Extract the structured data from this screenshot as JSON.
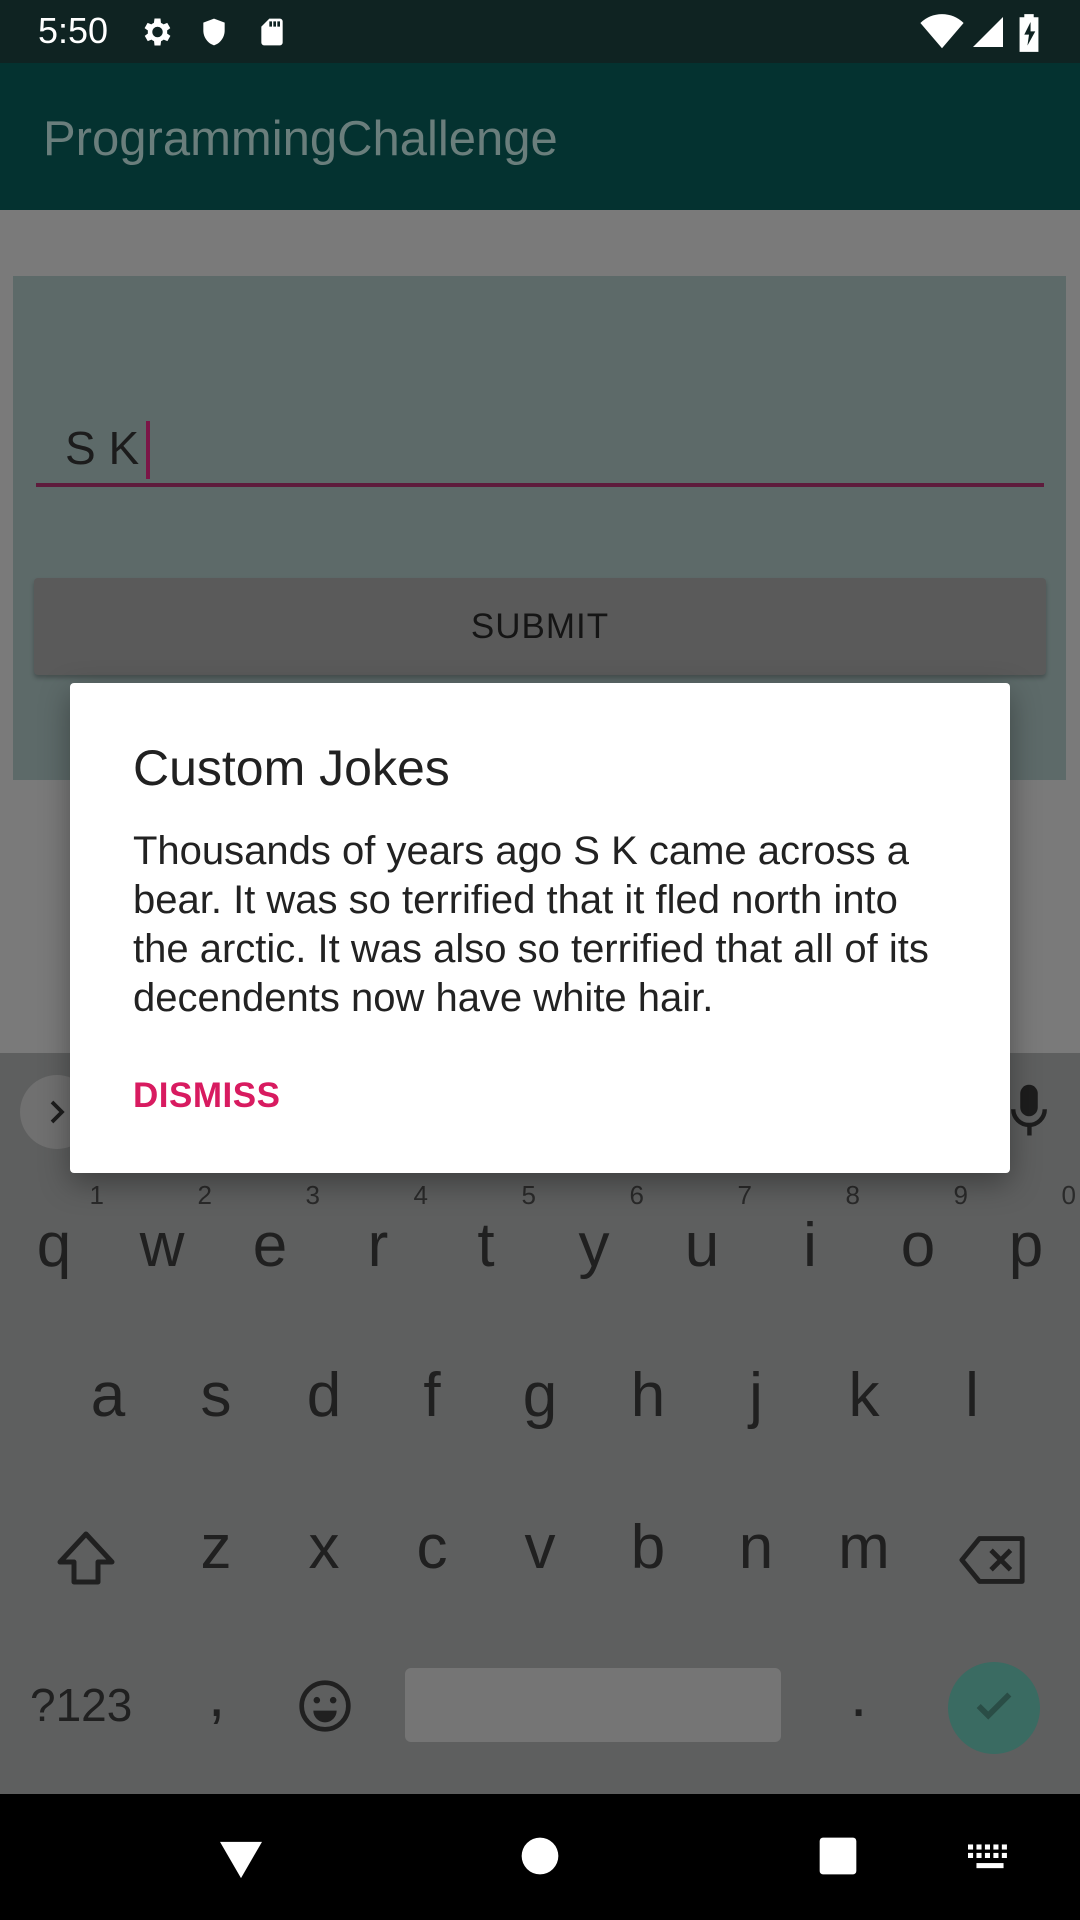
{
  "status_bar": {
    "time": "5:50",
    "left_icons": [
      "gear-icon",
      "shield-icon",
      "sd-card-icon"
    ],
    "right_icons": [
      "wifi-icon",
      "signal-icon",
      "battery-charging-icon"
    ]
  },
  "app_bar": {
    "title": "ProgrammingChallenge"
  },
  "form": {
    "name_value": "S K",
    "submit_label": "SUBMIT"
  },
  "dialog": {
    "title": "Custom Jokes",
    "message": "Thousands of years ago  S K came across a bear. It was so terrified that it fled north into the arctic. It was also so terrified that all of its decendents now have white hair.",
    "dismiss_label": "DISMISS"
  },
  "keyboard": {
    "row1": [
      {
        "key": "q",
        "hint": "1"
      },
      {
        "key": "w",
        "hint": "2"
      },
      {
        "key": "e",
        "hint": "3"
      },
      {
        "key": "r",
        "hint": "4"
      },
      {
        "key": "t",
        "hint": "5"
      },
      {
        "key": "y",
        "hint": "6"
      },
      {
        "key": "u",
        "hint": "7"
      },
      {
        "key": "i",
        "hint": "8"
      },
      {
        "key": "o",
        "hint": "9"
      },
      {
        "key": "p",
        "hint": "0"
      }
    ],
    "row2": [
      "a",
      "s",
      "d",
      "f",
      "g",
      "h",
      "j",
      "k",
      "l"
    ],
    "row3": [
      "z",
      "x",
      "c",
      "v",
      "b",
      "n",
      "m"
    ],
    "symbols_label": "?123",
    "comma": ",",
    "period": ".",
    "expand_icon": "chevron-right-icon",
    "mic_icon": "microphone-icon",
    "shift_icon": "shift-icon",
    "backspace_icon": "backspace-icon",
    "emoji_icon": "emoji-icon",
    "enter_icon": "check-icon",
    "accent_color": "#3a6b62"
  },
  "nav_bar": {
    "icons": [
      "back-icon",
      "home-icon",
      "recents-icon",
      "keyboard-switch-icon"
    ]
  }
}
